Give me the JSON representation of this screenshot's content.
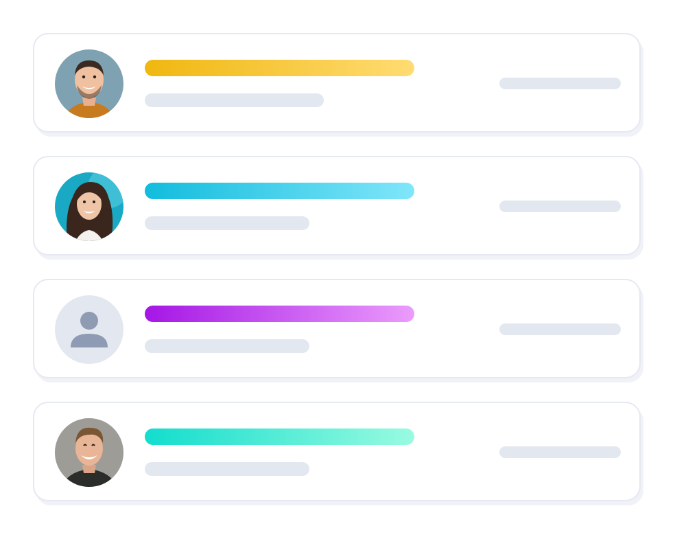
{
  "rows": [
    {
      "avatar": "man-smiling-photo-icon",
      "accent": [
        "#f0b70f",
        "#ffdc73"
      ]
    },
    {
      "avatar": "woman-smiling-photo-icon",
      "accent": [
        "#12bcdd",
        "#80e6fa"
      ]
    },
    {
      "avatar": "default-user-icon",
      "accent": [
        "#a516e6",
        "#eb9cfc"
      ]
    },
    {
      "avatar": "man-laughing-photo-icon",
      "accent": [
        "#12ddcd",
        "#99fbe0"
      ]
    }
  ]
}
